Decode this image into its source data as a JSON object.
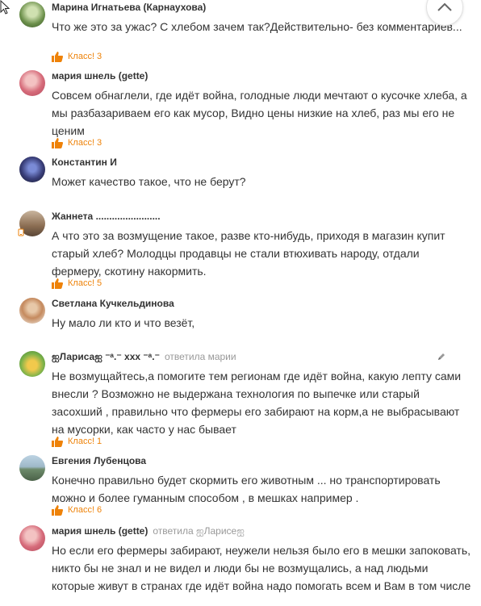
{
  "comments": [
    {
      "author": "Марина Игнатьева (Карнаухова)",
      "text": "Что же это за ужас? С хлебом зачем так?Действительно- без комментариев...",
      "like": "Класс! 3"
    },
    {
      "author": "мария шнель (gette)",
      "text": "Совсем обнаглели, где идёт война, голодные люди мечтают о кусочке хлеба, а мы разбазариваем его как мусор, Видно цены низкие на хлеб, раз мы его не ценим",
      "like": "Класс! 3"
    },
    {
      "author": "Константин И",
      "text": "Может качество такое, что не берут?"
    },
    {
      "author": "Жаннета ........................",
      "text": "А что это за возмущение такое, разве кто-нибудь, приходя в магазин купит старый хлеб? Молодцы продавцы не стали втюхивать народу, отдали фермеру, скотину накормить.",
      "like": "Класс! 5"
    },
    {
      "author": "Светлана Кучкельдинова",
      "text": "Ну мало ли кто и что везёт,"
    },
    {
      "author": "ஐЛарисаஐ ⁻ᵃ.⁻ xxx ⁻ᵃ.⁻",
      "reply": "ответила марии",
      "text": "Не возмущайтесь,а помогите  тем регионам где идёт война, какую лепту сами внесли ? Возможно не выдержана технология по выпечке или старый засохший , правильно что фермеры его забирают на корм,а не выбрасывают на мусорки, как часто у нас бывает",
      "like": "Класс! 1"
    },
    {
      "author": "Евгения Лубенцова",
      "text": "Конечно правильно будет скормить его животным ... но транспортировать можно и более гуманным способом , в мешках например .",
      "like": "Класс! 6"
    },
    {
      "author": "мария шнель (gette)",
      "reply": "ответила ஐЛарисеஐ",
      "text": "Но если его фермеры забирают, неужели нельзя было его в мешки запоковать, никто бы не знал и не видел и люди бы не возмущались, а над людьми которые живут в странах где идёт война надо помогать всем и Вам в том числе"
    }
  ],
  "colors": {
    "like": "#ee8208",
    "reply": "#999999",
    "text": "#333333"
  }
}
